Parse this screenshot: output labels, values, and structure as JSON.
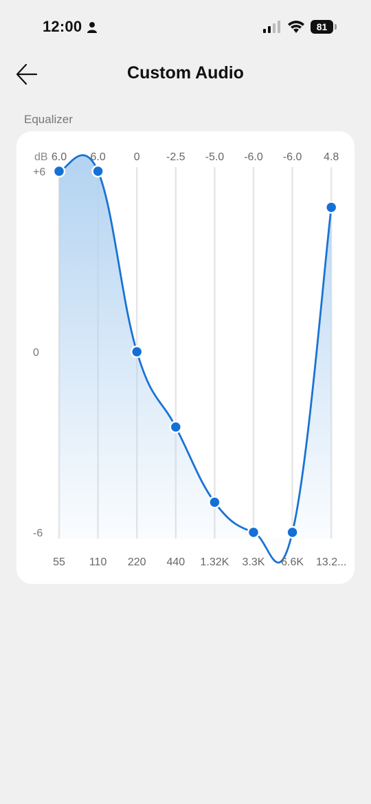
{
  "status_bar": {
    "time": "12:00",
    "battery": "81",
    "icons": [
      "person-icon",
      "cellular-signal-icon",
      "wifi-icon",
      "battery-icon"
    ]
  },
  "header": {
    "title": "Custom Audio",
    "back_icon": "arrow-left-icon"
  },
  "equalizer": {
    "section_label": "Equalizer",
    "unit_label": "dB",
    "y_ticks": [
      "+6",
      "0",
      "-6"
    ]
  },
  "chart_data": {
    "type": "line",
    "title": "",
    "xlabel": "",
    "ylabel": "dB",
    "categories": [
      "55",
      "110",
      "220",
      "440",
      "1.32K",
      "3.3K",
      "6.6K",
      "13.2..."
    ],
    "value_labels": [
      "6.0",
      "6.0",
      "0",
      "-2.5",
      "-5.0",
      "-6.0",
      "-6.0",
      "4.8"
    ],
    "values": [
      6.0,
      6.0,
      0,
      -2.5,
      -5.0,
      -6.0,
      -6.0,
      4.8
    ],
    "ylim": [
      -6,
      6
    ],
    "grid": true,
    "colors": {
      "line": "#1a73d4",
      "point": "#1570d6",
      "fill": "#b3d3f1",
      "grid": "#e6e6e6"
    }
  }
}
